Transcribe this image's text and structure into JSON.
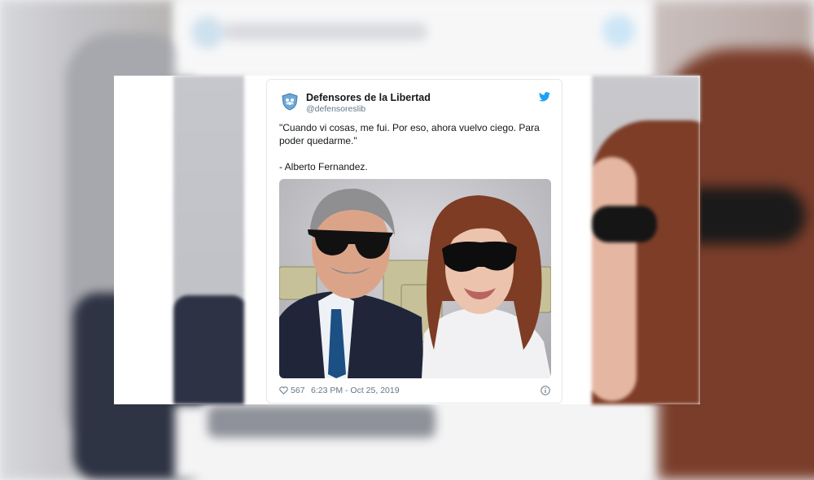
{
  "tweet": {
    "display_name": "Defensores de la Libertad",
    "handle": "@defensoreslib",
    "text_line1": "\"Cuando vi cosas, me fui. Por eso, ahora vuelvo ciego. Para poder quedarme.\"",
    "text_line2": "- Alberto Fernandez.",
    "likes": "567",
    "timestamp": "6:23 PM - Oct 25, 2019"
  },
  "icons": {
    "avatar": "shield-logo-icon",
    "brand": "twitter-bird-icon",
    "like": "heart-icon",
    "info": "info-icon"
  },
  "colors": {
    "twitter_blue": "#1da1f2",
    "text": "#14171a",
    "muted": "#657786"
  }
}
